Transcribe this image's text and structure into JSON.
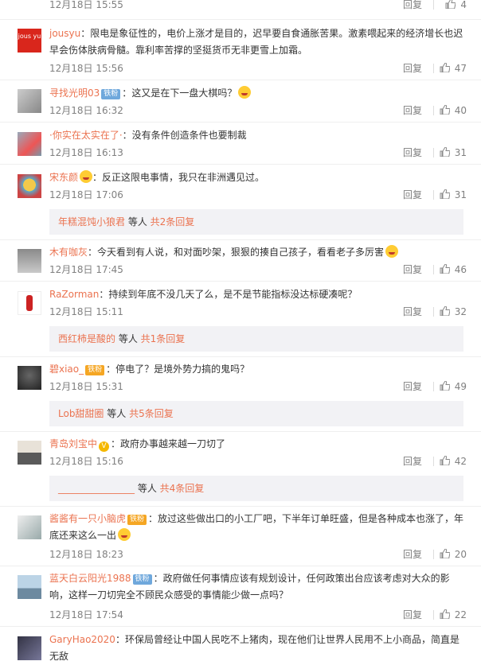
{
  "reply_label": "回复",
  "top_meta": {
    "time": "12月18日 15:55",
    "likes": "4"
  },
  "comments": [
    {
      "user": "jousyu",
      "text": "限电是象征性的，电价上涨才是目的，迟早要自食通胀苦果。激素喂起来的经济增长也迟早会伤体肤病骨髓。靠利率苦撑的坚挺货币无非更雪上加霜。",
      "time": "12月18日 15:56",
      "likes": "47",
      "avatar_text": "jous yu"
    },
    {
      "user": "寻找光明03",
      "badge": "铁粉",
      "text": "这又是在下一盘大棋吗？",
      "time": "12月18日 16:32",
      "likes": "40"
    },
    {
      "user": "·你实在太实在了·",
      "text": "没有条件创造条件也要制裁",
      "time": "12月18日 16:13",
      "likes": "31"
    },
    {
      "user": "宋东颜",
      "text": "反正这限电事情，我只在非洲遇见过。",
      "time": "12月18日 17:06",
      "likes": "31"
    },
    {
      "user": "木有咖灰",
      "text": "今天看到有人说，和对面吵架，狠狠的揍自己孩子，看看老子多厉害",
      "time": "12月18日 17:45",
      "likes": "46"
    },
    {
      "user": "RaZorman",
      "text": "持续到年底不没几天了么，是不是节能指标没达标硬凑呢？",
      "time": "12月18日 15:11",
      "likes": "32"
    },
    {
      "user": "碧xiao_",
      "badge": "铁粉",
      "text": "停电了？是境外势力搞的鬼吗？",
      "time": "12月18日 15:31",
      "likes": "49"
    },
    {
      "user": "青岛刘宝中",
      "text": "政府办事越来越一刀切了",
      "time": "12月18日 15:16",
      "likes": "42"
    },
    {
      "user": "酱酱有一只小脑虎",
      "badge": "铁粉",
      "text": "放过这些做出口的小工厂吧，下半年订单旺盛，但是各种成本也涨了，年底还来这么一出",
      "time": "12月18日 18:23",
      "likes": "20"
    },
    {
      "user": "蓝天白云阳光1988",
      "badge": "铁粉",
      "text": "政府做任何事情应该有规划设计，任何政策出台应该考虑对大众的影响，这样一刀切完全不顾民众感受的事情能少做一点吗？",
      "time": "12月18日 17:54",
      "likes": "22"
    },
    {
      "user": "GaryHao2020",
      "text": "环保局曾经让中国人民吃不上猪肉，现在他们让世界人民用不上小商品，简直是无敌",
      "time": "",
      "likes": ""
    }
  ],
  "sub_replies": [
    {
      "who": "年糕混饨小狼君",
      "etc": " 等人 ",
      "count": "共2条回复"
    },
    {
      "who": "西红柿是酸的",
      "etc": " 等人 ",
      "count": "共1条回复"
    },
    {
      "who": "Lob甜甜圈",
      "etc": " 等人 ",
      "count": "共5条回复"
    },
    {
      "who": "________________",
      "etc": " 等人 ",
      "count": "共4条回复"
    }
  ],
  "colors": {
    "username": "#eb7350",
    "meta": "#808080",
    "subbar_bg": "#f2f2f5"
  },
  "icons": {
    "like": "thumb-up-icon",
    "vip": "vip-crown-icon",
    "emoji": "laugh-emoji-icon"
  }
}
